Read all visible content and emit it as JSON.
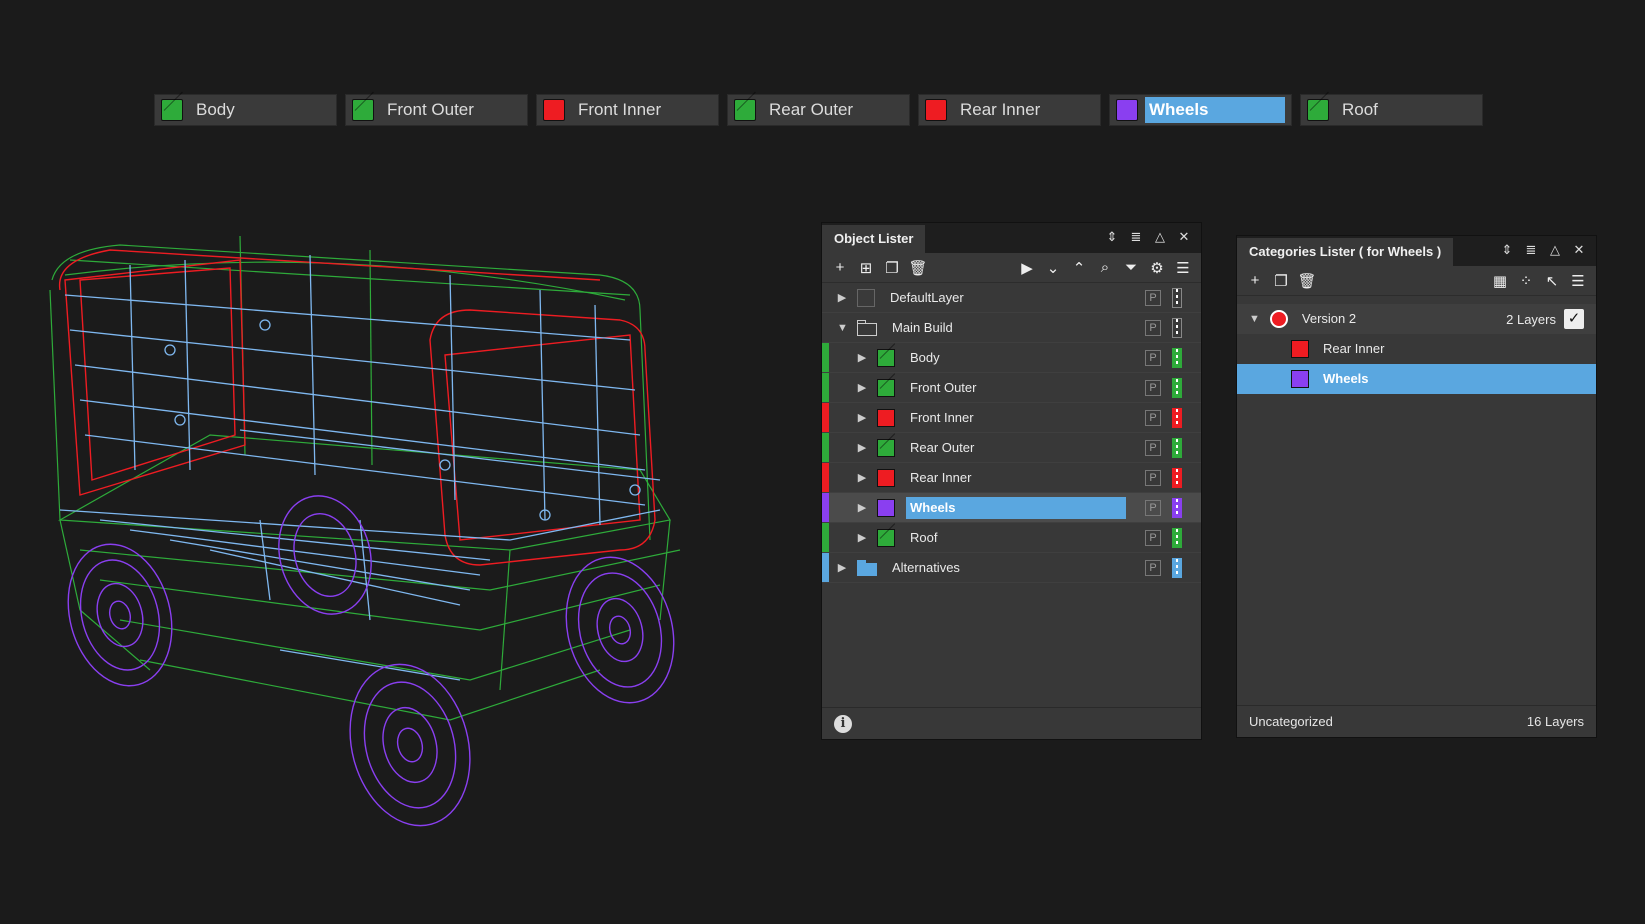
{
  "category_tabs": [
    {
      "label": "Body",
      "color": "#2eab3a",
      "active": false
    },
    {
      "label": "Front Outer",
      "color": "#2eab3a",
      "active": false
    },
    {
      "label": "Front Inner",
      "color": "#ee1c22",
      "active": false
    },
    {
      "label": "Rear Outer",
      "color": "#2eab3a",
      "active": false
    },
    {
      "label": "Rear Inner",
      "color": "#ee1c22",
      "active": false
    },
    {
      "label": "Wheels",
      "color": "#8a3ff0",
      "active": true
    },
    {
      "label": "Roof",
      "color": "#2eab3a",
      "active": false
    }
  ],
  "object_lister": {
    "title": "Object Lister",
    "header_icons": [
      "resize-icon",
      "menu-icon",
      "collapse-icon",
      "close-icon"
    ],
    "toolbar_left": [
      "add-icon",
      "add-group-icon",
      "duplicate-icon",
      "delete-icon"
    ],
    "toolbar_right": [
      "play-icon",
      "chevron-down-icon",
      "chevron-up-icon",
      "search-icon",
      "filter-icon",
      "gear-icon",
      "menu-icon"
    ],
    "p_label": "P",
    "rows": [
      {
        "label": "DefaultLayer",
        "kind": "layer-empty"
      },
      {
        "label": "Main Build",
        "kind": "folder",
        "expanded": true
      },
      {
        "label": "Body",
        "kind": "child",
        "color": "#2eab3a"
      },
      {
        "label": "Front Outer",
        "kind": "child",
        "color": "#2eab3a"
      },
      {
        "label": "Front Inner",
        "kind": "child",
        "color": "#ee1c22"
      },
      {
        "label": "Rear Outer",
        "kind": "child",
        "color": "#2eab3a"
      },
      {
        "label": "Rear Inner",
        "kind": "child",
        "color": "#ee1c22"
      },
      {
        "label": "Wheels",
        "kind": "child",
        "color": "#8a3ff0",
        "selected": true
      },
      {
        "label": "Roof",
        "kind": "child",
        "color": "#2eab3a"
      },
      {
        "label": "Alternatives",
        "kind": "folder-blue",
        "color": "#5aa7e0"
      }
    ]
  },
  "categories_lister": {
    "title": "Categories Lister ( for Wheels )",
    "header_icons": [
      "resize-icon",
      "menu-icon",
      "collapse-icon",
      "close-icon"
    ],
    "toolbar_left": [
      "add-icon",
      "duplicate-icon",
      "delete-icon"
    ],
    "toolbar_right": [
      "grid-outline-icon",
      "grid-icon",
      "select-icon",
      "menu-icon"
    ],
    "version": {
      "label": "Version 2",
      "count": "2 Layers",
      "checked": true
    },
    "items": [
      {
        "label": "Rear Inner",
        "color": "#ee1c22",
        "selected": false
      },
      {
        "label": "Wheels",
        "color": "#8a3ff0",
        "selected": true
      }
    ],
    "footer": {
      "label": "Uncategorized",
      "count": "16 Layers"
    }
  },
  "colors": {
    "green": "#2eab3a",
    "red": "#ee1c22",
    "purple": "#8a3ff0",
    "blue": "#5aa7e0",
    "wire_blue": "#7fb8f0"
  }
}
